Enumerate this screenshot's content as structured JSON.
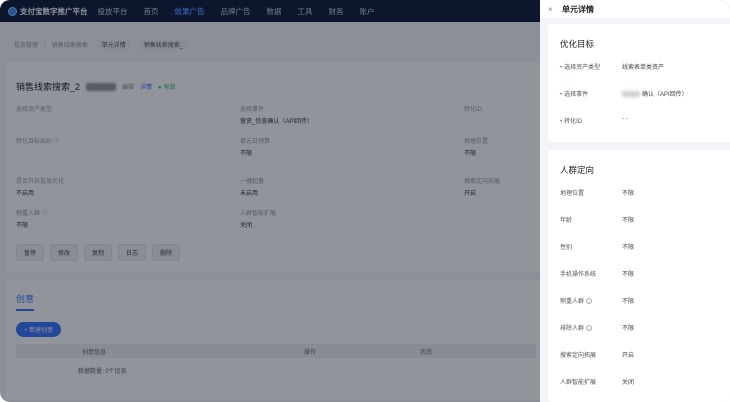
{
  "topnav": {
    "logo_text": "支付宝数字推广平台",
    "items": [
      {
        "label": "投放平台",
        "active": false
      },
      {
        "label": "首页",
        "active": false
      },
      {
        "label": "效果广告",
        "active": true
      },
      {
        "label": "品牌广告",
        "active": false
      },
      {
        "label": "数据",
        "active": false
      },
      {
        "label": "工具",
        "active": false
      },
      {
        "label": "财务",
        "active": false
      },
      {
        "label": "账户",
        "active": false
      }
    ]
  },
  "breadcrumb": {
    "items": [
      "投放管理",
      "销售线索搜索"
    ],
    "tags": [
      "单元详情",
      "销售线索搜索_"
    ]
  },
  "unit_card": {
    "title": "销售线索搜索_2",
    "dim_text": "编辑",
    "edit_label": "详情",
    "status": "● 有效",
    "fields": [
      {
        "label": "选择资产类型",
        "value": ""
      },
      {
        "label": "选择事件",
        "value": "留资_信息确认（API回传）"
      },
      {
        "label": "转化ID",
        "value": ""
      },
      {
        "label": "转化目标出价 ⓘ",
        "value": ""
      },
      {
        "label": "单元日预算",
        "value": "不限"
      },
      {
        "label": "地理位置",
        "value": "不限"
      },
      {
        "label": "是否开启投放优化",
        "value": "不启用"
      },
      {
        "label": "一键起量",
        "value": "未启用"
      },
      {
        "label": "搜索定向拓展",
        "value": "开启"
      },
      {
        "label": "侧重人群 ⓘ",
        "value": "不限"
      },
      {
        "label": "人群智能扩展",
        "value": "关闭"
      }
    ],
    "actions": [
      "暂停",
      "修改",
      "复制",
      "日志",
      "删除"
    ]
  },
  "creative": {
    "tab_label": "创意",
    "new_button": "+ 新建创意",
    "table_headers": [
      "",
      "创意信息",
      "操作",
      "状态"
    ],
    "footer": "数据数量: 0个信息"
  },
  "drawer": {
    "close_icon": "×",
    "title": "单元详情",
    "goal_section": {
      "title": "优化目标",
      "rows": [
        {
          "label": "选择资产类型",
          "required": true,
          "value": "线索表单类资产"
        },
        {
          "label": "选择事件",
          "required": true,
          "value": "确认（API回传）"
        },
        {
          "label": "转化ID",
          "required": true,
          "value": "- -"
        }
      ]
    },
    "audience_section": {
      "title": "人群定向",
      "rows": [
        {
          "label": "地理位置",
          "info": false,
          "value": "不限"
        },
        {
          "label": "年龄",
          "info": false,
          "value": "不限"
        },
        {
          "label": "性别",
          "info": false,
          "value": "不限"
        },
        {
          "label": "手机操作系统",
          "info": false,
          "value": "不限"
        },
        {
          "label": "侧重人群",
          "info": true,
          "value": "不限"
        },
        {
          "label": "排除人群",
          "info": true,
          "value": "不限"
        },
        {
          "label": "搜索定向拓展",
          "info": false,
          "value": "开启"
        },
        {
          "label": "人群智能扩展",
          "info": false,
          "value": "关闭"
        }
      ]
    }
  },
  "colors": {
    "nav_bg": "#0d1a3a",
    "accent": "#3773ff",
    "required": "#e54848",
    "status_green": "#1dbd71"
  }
}
